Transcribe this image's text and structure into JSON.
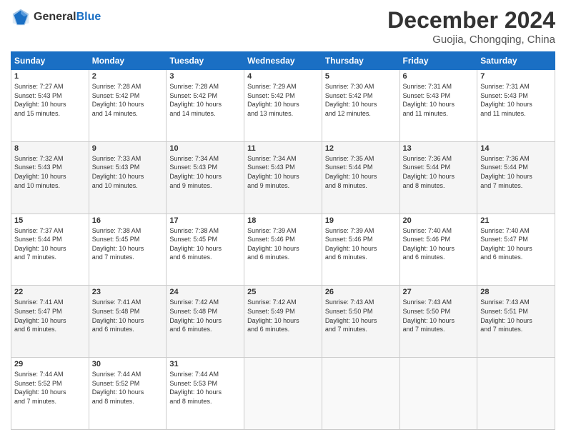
{
  "header": {
    "logo_line1": "General",
    "logo_line2": "Blue",
    "month_title": "December 2024",
    "location": "Guojia, Chongqing, China"
  },
  "calendar": {
    "days_of_week": [
      "Sunday",
      "Monday",
      "Tuesday",
      "Wednesday",
      "Thursday",
      "Friday",
      "Saturday"
    ],
    "weeks": [
      [
        {
          "day": "",
          "info": ""
        },
        {
          "day": "2",
          "info": "Sunrise: 7:28 AM\nSunset: 5:42 PM\nDaylight: 10 hours\nand 14 minutes."
        },
        {
          "day": "3",
          "info": "Sunrise: 7:28 AM\nSunset: 5:42 PM\nDaylight: 10 hours\nand 14 minutes."
        },
        {
          "day": "4",
          "info": "Sunrise: 7:29 AM\nSunset: 5:42 PM\nDaylight: 10 hours\nand 13 minutes."
        },
        {
          "day": "5",
          "info": "Sunrise: 7:30 AM\nSunset: 5:42 PM\nDaylight: 10 hours\nand 12 minutes."
        },
        {
          "day": "6",
          "info": "Sunrise: 7:31 AM\nSunset: 5:43 PM\nDaylight: 10 hours\nand 11 minutes."
        },
        {
          "day": "7",
          "info": "Sunrise: 7:31 AM\nSunset: 5:43 PM\nDaylight: 10 hours\nand 11 minutes."
        }
      ],
      [
        {
          "day": "1",
          "info": "Sunrise: 7:27 AM\nSunset: 5:43 PM\nDaylight: 10 hours\nand 15 minutes."
        },
        {
          "day": "",
          "info": ""
        },
        {
          "day": "",
          "info": ""
        },
        {
          "day": "",
          "info": ""
        },
        {
          "day": "",
          "info": ""
        },
        {
          "day": "",
          "info": ""
        },
        {
          "day": ""
        }
      ],
      [
        {
          "day": "8",
          "info": "Sunrise: 7:32 AM\nSunset: 5:43 PM\nDaylight: 10 hours\nand 10 minutes."
        },
        {
          "day": "9",
          "info": "Sunrise: 7:33 AM\nSunset: 5:43 PM\nDaylight: 10 hours\nand 10 minutes."
        },
        {
          "day": "10",
          "info": "Sunrise: 7:34 AM\nSunset: 5:43 PM\nDaylight: 10 hours\nand 9 minutes."
        },
        {
          "day": "11",
          "info": "Sunrise: 7:34 AM\nSunset: 5:43 PM\nDaylight: 10 hours\nand 9 minutes."
        },
        {
          "day": "12",
          "info": "Sunrise: 7:35 AM\nSunset: 5:44 PM\nDaylight: 10 hours\nand 8 minutes."
        },
        {
          "day": "13",
          "info": "Sunrise: 7:36 AM\nSunset: 5:44 PM\nDaylight: 10 hours\nand 8 minutes."
        },
        {
          "day": "14",
          "info": "Sunrise: 7:36 AM\nSunset: 5:44 PM\nDaylight: 10 hours\nand 7 minutes."
        }
      ],
      [
        {
          "day": "15",
          "info": "Sunrise: 7:37 AM\nSunset: 5:44 PM\nDaylight: 10 hours\nand 7 minutes."
        },
        {
          "day": "16",
          "info": "Sunrise: 7:38 AM\nSunset: 5:45 PM\nDaylight: 10 hours\nand 7 minutes."
        },
        {
          "day": "17",
          "info": "Sunrise: 7:38 AM\nSunset: 5:45 PM\nDaylight: 10 hours\nand 6 minutes."
        },
        {
          "day": "18",
          "info": "Sunrise: 7:39 AM\nSunset: 5:46 PM\nDaylight: 10 hours\nand 6 minutes."
        },
        {
          "day": "19",
          "info": "Sunrise: 7:39 AM\nSunset: 5:46 PM\nDaylight: 10 hours\nand 6 minutes."
        },
        {
          "day": "20",
          "info": "Sunrise: 7:40 AM\nSunset: 5:46 PM\nDaylight: 10 hours\nand 6 minutes."
        },
        {
          "day": "21",
          "info": "Sunrise: 7:40 AM\nSunset: 5:47 PM\nDaylight: 10 hours\nand 6 minutes."
        }
      ],
      [
        {
          "day": "22",
          "info": "Sunrise: 7:41 AM\nSunset: 5:47 PM\nDaylight: 10 hours\nand 6 minutes."
        },
        {
          "day": "23",
          "info": "Sunrise: 7:41 AM\nSunset: 5:48 PM\nDaylight: 10 hours\nand 6 minutes."
        },
        {
          "day": "24",
          "info": "Sunrise: 7:42 AM\nSunset: 5:48 PM\nDaylight: 10 hours\nand 6 minutes."
        },
        {
          "day": "25",
          "info": "Sunrise: 7:42 AM\nSunset: 5:49 PM\nDaylight: 10 hours\nand 6 minutes."
        },
        {
          "day": "26",
          "info": "Sunrise: 7:43 AM\nSunset: 5:50 PM\nDaylight: 10 hours\nand 7 minutes."
        },
        {
          "day": "27",
          "info": "Sunrise: 7:43 AM\nSunset: 5:50 PM\nDaylight: 10 hours\nand 7 minutes."
        },
        {
          "day": "28",
          "info": "Sunrise: 7:43 AM\nSunset: 5:51 PM\nDaylight: 10 hours\nand 7 minutes."
        }
      ],
      [
        {
          "day": "29",
          "info": "Sunrise: 7:44 AM\nSunset: 5:52 PM\nDaylight: 10 hours\nand 7 minutes."
        },
        {
          "day": "30",
          "info": "Sunrise: 7:44 AM\nSunset: 5:52 PM\nDaylight: 10 hours\nand 8 minutes."
        },
        {
          "day": "31",
          "info": "Sunrise: 7:44 AM\nSunset: 5:53 PM\nDaylight: 10 hours\nand 8 minutes."
        },
        {
          "day": "",
          "info": ""
        },
        {
          "day": "",
          "info": ""
        },
        {
          "day": "",
          "info": ""
        },
        {
          "day": "",
          "info": ""
        }
      ]
    ]
  }
}
